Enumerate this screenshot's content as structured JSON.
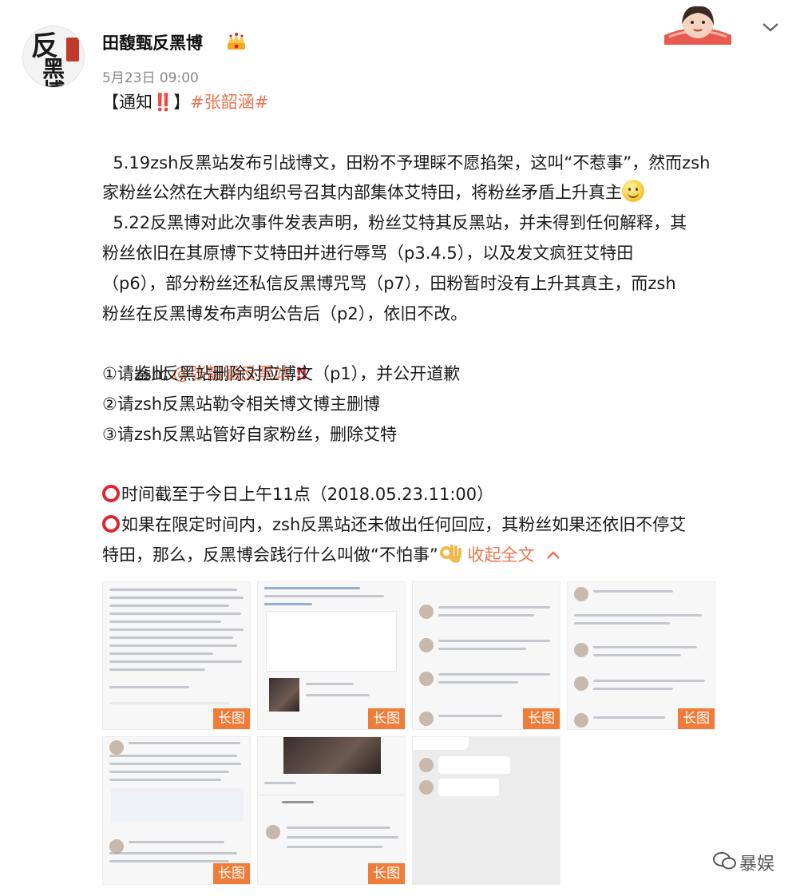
{
  "post": {
    "username": "田馥甄反黑博",
    "badge_icon": "crown-badge-icon",
    "timestamp": "5月23日 09:00",
    "avatar_stamp_top": "反",
    "avatar_stamp_bottom": "黑博"
  },
  "content": {
    "notice_prefix": "【通知",
    "notice_mark": "‼️",
    "notice_suffix": "】",
    "hashtag": "#张韶涵#",
    "p1_l1": "  5.19zsh反黑站发布引战博文，田粉不予理睬不愿掐架，这叫“不惹事”，然而zsh",
    "p1_l2": "家粉丝公然在大群内组织号召其内部集体艾特田，将粉丝矛盾上升真主",
    "p2_l1": "  5.22反黑博对此次事件发表声明，粉丝艾特其反黑站，并未得到任何解释，其",
    "p2_l2": "粉丝依旧在其原博下艾特田并进行辱骂（p3.4.5），以及发文疯狂艾特田",
    "p2_l3": "（p6），部分粉丝还私信反黑博咒骂（p7），田粉暂时没有上升其真主，而zsh",
    "p2_l4": "粉丝在反黑博发布声明公告后（p2），依旧不改。",
    "jianci": "  鉴此 ",
    "mention": "@张韶涵反黑站",
    "jianci_mark": " ‼",
    "req1": "①请zsh反黑站删除对应博文（p1），并公开道歉",
    "req2": "②请zsh反黑站勒令相关博文博主删博",
    "req3": "③请zsh反黑站管好自家粉丝，删除艾特",
    "deadline": "时间截至于今日上午11点（2018.05.23.11:00）",
    "warn_l1": "如果在限定时间内，zsh反黑站还未做出任何回应，其粉丝如果还依旧不停艾",
    "warn_l2": "特田，那么，反黑博会践行什么叫做“不怕事”",
    "collapse": " 收起全文"
  },
  "images": {
    "long_image_tag": "长图"
  },
  "watermark": {
    "text": "暴娱"
  },
  "colors": {
    "link": "#eb7350",
    "alert": "#e0242f",
    "tag_bg": "#ef7d3a"
  }
}
